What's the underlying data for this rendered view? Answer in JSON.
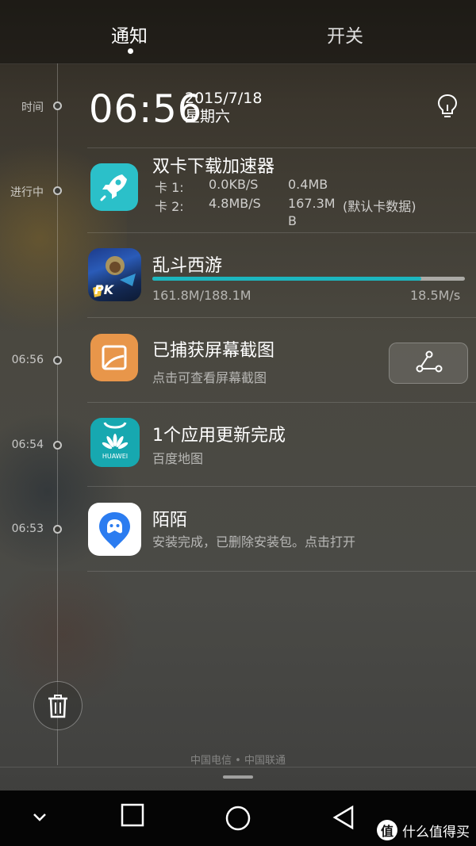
{
  "tabs": [
    {
      "label": "通知",
      "active": true
    },
    {
      "label": "开关",
      "active": false
    }
  ],
  "timeline": {
    "labels": [
      "时间",
      "进行中",
      "06:56",
      "06:54",
      "06:53"
    ]
  },
  "clock": {
    "time": "06:56",
    "date": "2015/7/18",
    "weekday": "星期六"
  },
  "notifications": {
    "dual_sim": {
      "title": "双卡下载加速器",
      "sim1_label": "卡 1:",
      "sim1_speed": "0.0KB/S",
      "sim1_total": "0.4MB",
      "sim2_label": "卡 2:",
      "sim2_speed": "4.8MB/S",
      "sim2_total": "167.3M",
      "sim2_total_b": "B",
      "sim2_note": "(默认卡数据)",
      "icon_color": "#2bc0c9"
    },
    "game_download": {
      "title": "乱斗西游",
      "progress_text": "161.8M/188.1M",
      "speed": "18.5M/s",
      "progress": 0.86,
      "progress_color": "#1cb6bf"
    },
    "screenshot": {
      "title": "已捕获屏幕截图",
      "subtitle": "点击可查看屏幕截图",
      "icon_color": "#e8964a"
    },
    "app_update": {
      "title": "1个应用更新完成",
      "subtitle": "百度地图",
      "icon_text": "HUAWEI",
      "icon_color": "#17a8b0"
    },
    "momo": {
      "title": "陌陌",
      "subtitle": "安装完成，已删除安装包。点击打开",
      "icon_color": "#2b7cf0"
    }
  },
  "carrier": "中国电信 • 中国联通",
  "watermark": {
    "badge": "值",
    "text": "什么值得买"
  },
  "icons": {
    "bulb": "lightbulb-icon",
    "share": "share-icon",
    "trash": "trash-icon",
    "nav_back": "triangle-back-icon",
    "nav_home": "circle-home-icon",
    "nav_recent": "square-recent-icon",
    "nav_collapse": "chevron-down-icon"
  }
}
